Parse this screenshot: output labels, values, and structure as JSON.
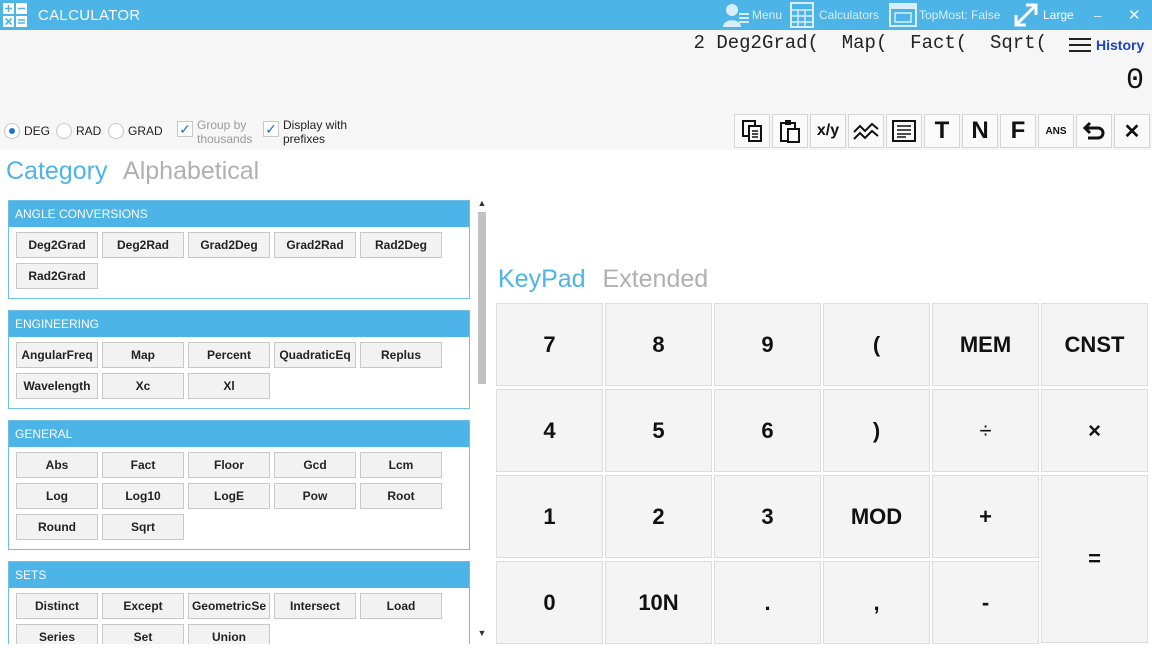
{
  "titlebar": {
    "title": "CALCULATOR",
    "menu": "Menu",
    "calculators": "Calculators",
    "topmost": "TopMost: False",
    "size": "Large",
    "minimize": "–",
    "close": "✕"
  },
  "display": {
    "expression": "2 Deg2Grad(  Map(  Fact(  Sqrt(",
    "history": "History",
    "result": "0"
  },
  "options": {
    "deg": "DEG",
    "rad": "RAD",
    "grad": "GRAD",
    "selected_unit": "DEG",
    "group_thousands_1": "Group by",
    "group_thousands_2": "thousands",
    "group_thousands_checked": true,
    "prefixes_1": "Display with",
    "prefixes_2": "prefixes",
    "prefixes_checked": true
  },
  "tools": {
    "copy": "copy-icon",
    "paste": "paste-icon",
    "xy": "x/y",
    "graph": "graph-icon",
    "text": "text-list-icon",
    "t": "T",
    "n": "N",
    "f": "F",
    "ans": "ANS",
    "undo": "undo-icon",
    "clear": "✕"
  },
  "function_tabs": {
    "active": "Category",
    "inactive": "Alphabetical"
  },
  "groups": [
    {
      "name": "ANGLE CONVERSIONS",
      "buttons": [
        "Deg2Grad",
        "Deg2Rad",
        "Grad2Deg",
        "Grad2Rad",
        "Rad2Deg",
        "Rad2Grad"
      ]
    },
    {
      "name": "ENGINEERING",
      "buttons": [
        "AngularFreq",
        "Map",
        "Percent",
        "QuadraticEq",
        "Replus",
        "Wavelength",
        "Xc",
        "Xl"
      ]
    },
    {
      "name": "GENERAL",
      "buttons": [
        "Abs",
        "Fact",
        "Floor",
        "Gcd",
        "Lcm",
        "Log",
        "Log10",
        "LogE",
        "Pow",
        "Root",
        "Round",
        "Sqrt"
      ]
    },
    {
      "name": "SETS",
      "buttons": [
        "Distinct",
        "Except",
        "GeometricSe",
        "Intersect",
        "Load",
        "Series",
        "Set",
        "Union"
      ]
    }
  ],
  "keypad_tabs": {
    "active": "KeyPad",
    "inactive": "Extended"
  },
  "keys": {
    "k7": "7",
    "k8": "8",
    "k9": "9",
    "lparen": "(",
    "mem": "MEM",
    "cnst": "CNST",
    "k4": "4",
    "k5": "5",
    "k6": "6",
    "rparen": ")",
    "div": "÷",
    "mul": "×",
    "k1": "1",
    "k2": "2",
    "k3": "3",
    "mod": "MOD",
    "plus": "+",
    "equals": "=",
    "k0": "0",
    "k10n": "10N",
    "dot": ".",
    "comma": ",",
    "minus": "-"
  },
  "colors": {
    "accent": "#4cb4e6",
    "history_link": "#1a44c8"
  }
}
